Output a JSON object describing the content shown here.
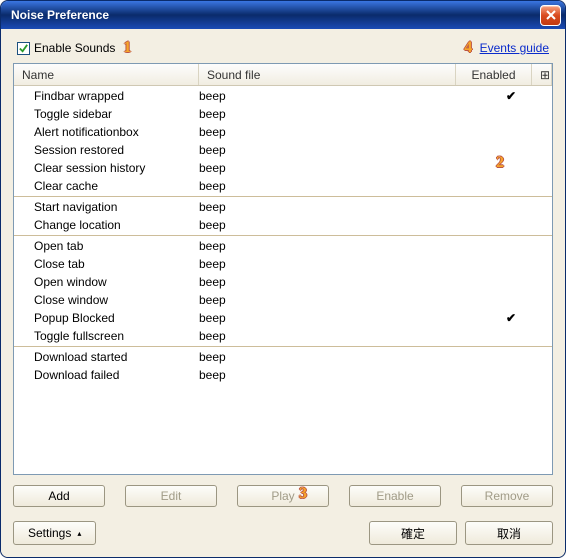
{
  "window": {
    "title": "Noise Preference"
  },
  "top": {
    "enable_sounds_label": "Enable Sounds",
    "enable_sounds_checked": true,
    "events_guide_label": "Events guide"
  },
  "annotations": {
    "a1": "1",
    "a2": "2",
    "a3": "3",
    "a4": "4"
  },
  "columns": {
    "name": "Name",
    "sound": "Sound file",
    "enabled": "Enabled",
    "cfg": "⊞"
  },
  "groups": [
    {
      "rows": [
        {
          "name": "Findbar wrapped",
          "sound": "beep",
          "enabled": true
        },
        {
          "name": "Toggle sidebar",
          "sound": "beep",
          "enabled": false
        },
        {
          "name": "Alert notificationbox",
          "sound": "beep",
          "enabled": false
        },
        {
          "name": "Session restored",
          "sound": "beep",
          "enabled": false
        },
        {
          "name": "Clear session history",
          "sound": "beep",
          "enabled": false
        },
        {
          "name": "Clear cache",
          "sound": "beep",
          "enabled": false
        }
      ]
    },
    {
      "rows": [
        {
          "name": "Start navigation",
          "sound": "beep",
          "enabled": false
        },
        {
          "name": "Change location",
          "sound": "beep",
          "enabled": false
        }
      ]
    },
    {
      "rows": [
        {
          "name": "Open tab",
          "sound": "beep",
          "enabled": false
        },
        {
          "name": "Close tab",
          "sound": "beep",
          "enabled": false
        },
        {
          "name": "Open window",
          "sound": "beep",
          "enabled": false
        },
        {
          "name": "Close window",
          "sound": "beep",
          "enabled": false
        },
        {
          "name": "Popup Blocked",
          "sound": "beep",
          "enabled": true
        },
        {
          "name": "Toggle fullscreen",
          "sound": "beep",
          "enabled": false
        }
      ]
    },
    {
      "rows": [
        {
          "name": "Download started",
          "sound": "beep",
          "enabled": false
        },
        {
          "name": "Download failed",
          "sound": "beep",
          "enabled": false
        }
      ]
    }
  ],
  "buttons": {
    "add": "Add",
    "edit": "Edit",
    "play": "Play",
    "enable": "Enable",
    "remove": "Remove",
    "settings": "Settings",
    "ok": "確定",
    "cancel": "取消"
  }
}
